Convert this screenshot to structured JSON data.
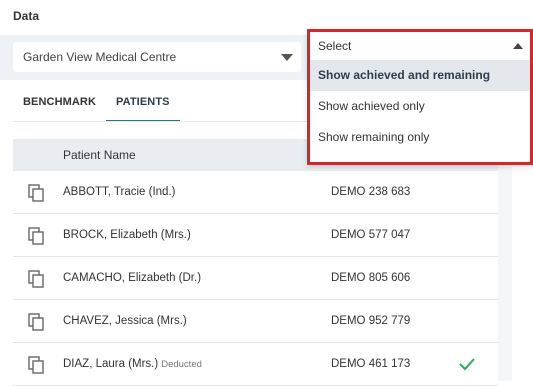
{
  "section_title": "Data",
  "practice_select": {
    "value": "Garden View Medical Centre"
  },
  "tabs": [
    {
      "label": "BENCHMARK",
      "active": false
    },
    {
      "label": "PATIENTS",
      "active": true
    }
  ],
  "table": {
    "columns": {
      "name": "Patient Name"
    },
    "rows": [
      {
        "name": "ABBOTT, Tracie (Ind.)",
        "tag": "",
        "nhi": "DEMO 238 683",
        "achieved": false
      },
      {
        "name": "BROCK, Elizabeth (Mrs.)",
        "tag": "",
        "nhi": "DEMO 577 047",
        "achieved": false
      },
      {
        "name": "CAMACHO, Elizabeth (Dr.)",
        "tag": "",
        "nhi": "DEMO 805 606",
        "achieved": false
      },
      {
        "name": "CHAVEZ, Jessica (Mrs.)",
        "tag": "",
        "nhi": "DEMO 952 779",
        "achieved": false
      },
      {
        "name": "DIAZ, Laura (Mrs.)",
        "tag": "Deducted",
        "nhi": "DEMO 461 173",
        "achieved": true
      }
    ]
  },
  "status_dropdown": {
    "placeholder": "Select",
    "options": [
      {
        "label": "Show achieved and remaining",
        "highlighted": true
      },
      {
        "label": "Show achieved only",
        "highlighted": false
      },
      {
        "label": "Show remaining only",
        "highlighted": false
      }
    ],
    "outline_color": "#d6262a"
  },
  "colors": {
    "check": "#2eaa58",
    "accent": "#1f7a8c"
  }
}
